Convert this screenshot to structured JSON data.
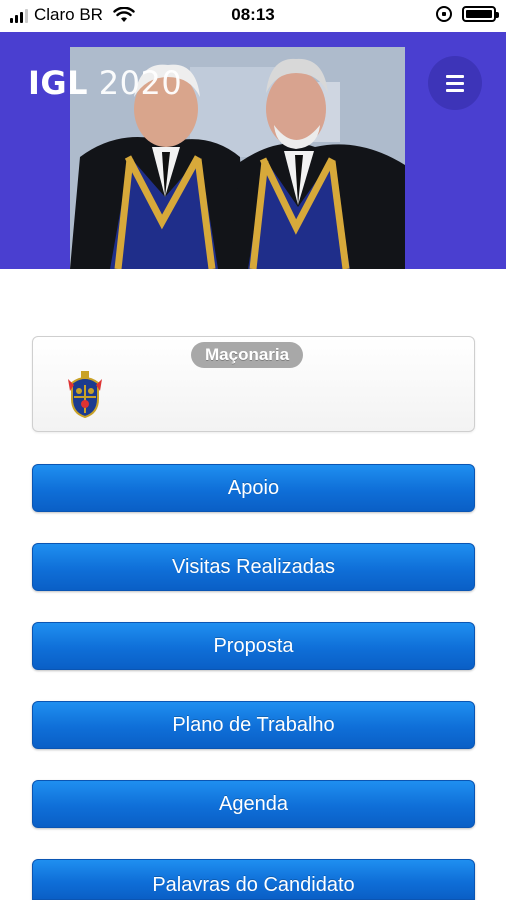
{
  "status_bar": {
    "carrier": "Claro BR",
    "time": "08:13",
    "icons": [
      "signal-icon",
      "wifi-icon",
      "orientation-lock-icon",
      "battery-icon"
    ]
  },
  "header": {
    "brand_bold": "IGL",
    "brand_light": " 2020",
    "menu_icon": "hamburger-menu-icon",
    "background_color": "#4a3fd0"
  },
  "card": {
    "badge": "Maçonaria",
    "icon": "masonic-crest-icon"
  },
  "menu": {
    "items": [
      {
        "label": "Apoio"
      },
      {
        "label": "Visitas Realizadas"
      },
      {
        "label": "Proposta"
      },
      {
        "label": "Plano de Trabalho"
      },
      {
        "label": "Agenda"
      },
      {
        "label": "Palavras do Candidato"
      }
    ],
    "button_color": "#1479e3"
  }
}
